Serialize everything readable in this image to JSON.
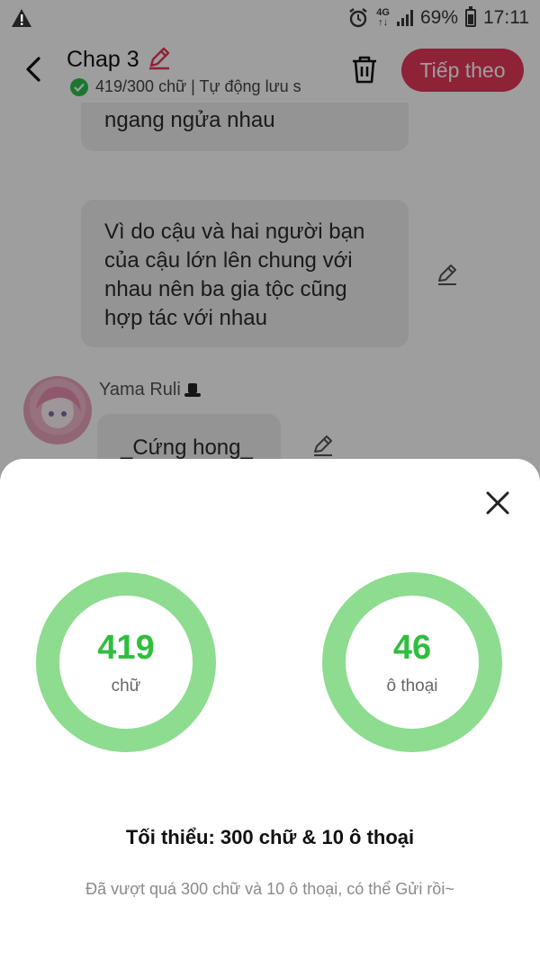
{
  "status_bar": {
    "network": "4G",
    "battery_percent": "69%",
    "time": "17:11",
    "icons": [
      "warning-icon",
      "alarm-icon",
      "signal-icon",
      "battery-icon"
    ]
  },
  "header": {
    "title": "Chap 3",
    "word_status": "419/300 chữ | Tự động lưu s",
    "next_label": "Tiếp theo",
    "accent_color": "#e5375a"
  },
  "chat": {
    "bubble_1_text": "ngang ngửa nhau",
    "bubble_2_text": "Vì do cậu và hai người bạn của cậu lớn lên chung với nhau nên ba gia tộc cũng hợp tác với nhau",
    "username": "Yama Ruli",
    "bubble_3_text": "_Cứng hong_"
  },
  "sheet": {
    "words": {
      "value": "419",
      "label": "chữ"
    },
    "dialogs": {
      "value": "46",
      "label": "ô thoại"
    },
    "minimum_text": "Tối thiểu: 300 chữ & 10 ô thoại",
    "note_text": "Đã vượt quá 300 chữ và 10 ô thoại, có thể Gửi rồi~",
    "ring_color": "#8ddc8f",
    "number_color": "#2fbe3e"
  }
}
